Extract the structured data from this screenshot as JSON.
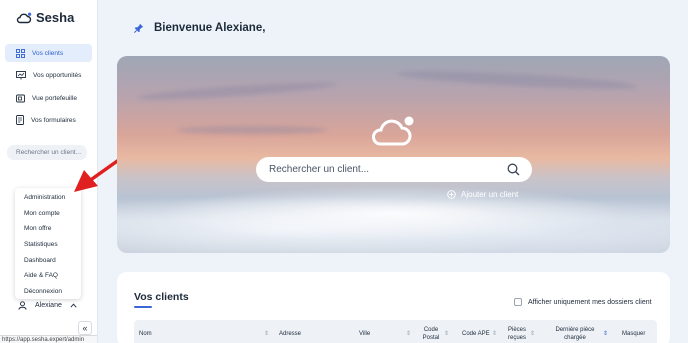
{
  "app": {
    "name": "Sesha"
  },
  "sidebar": {
    "items": [
      {
        "label": "Vos clients",
        "icon": "grid-icon",
        "active": true
      },
      {
        "label": "Vos opportunités",
        "icon": "presentation-icon",
        "active": false
      },
      {
        "label": "Vue portefeuille",
        "icon": "wallet-icon",
        "active": false
      },
      {
        "label": "Vos formulaires",
        "icon": "form-icon",
        "active": false
      }
    ],
    "search_placeholder": "Rechercher un client...",
    "menu": [
      "Administration",
      "Mon compte",
      "Mon offre",
      "Statistiques",
      "Dashboard",
      "Aide & FAQ",
      "Déconnexion"
    ],
    "user_name": "Alexiane",
    "collapse_label": "«"
  },
  "status_url": "https://app.sesha.expert/admin",
  "header": {
    "welcome": "Bienvenue Alexiane,"
  },
  "hero": {
    "search_placeholder": "Rechercher un client...",
    "add_client_label": "Ajouter un client"
  },
  "clients": {
    "title": "Vos clients",
    "only_mine_label": "Afficher uniquement mes dossiers client",
    "columns": [
      "Nom",
      "Adresse",
      "Ville",
      "Code Postal",
      "Code APE",
      "Pièces reçues",
      "Dernière pièce chargée",
      "Masquer"
    ]
  },
  "colors": {
    "accent": "#3b66d6",
    "active_bg": "#e4edfb",
    "background": "#eef3f9",
    "annotation_arrow": "#e02020"
  }
}
